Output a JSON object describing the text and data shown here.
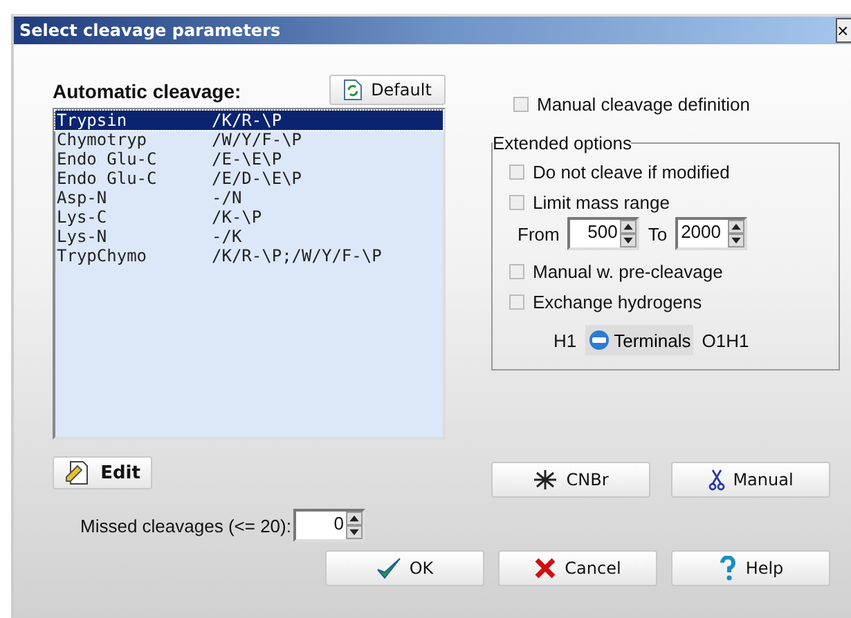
{
  "window": {
    "title": "Select cleavage parameters",
    "close": "×"
  },
  "automatic": {
    "label": "Automatic cleavage:",
    "default_button": "Default",
    "enzymes": [
      {
        "name": "Trypsin",
        "rule": "/K/R-\\P",
        "selected": true
      },
      {
        "name": "Chymotryp",
        "rule": "/W/Y/F-\\P",
        "selected": false
      },
      {
        "name": "Endo Glu-C",
        "rule": "/E-\\E\\P",
        "selected": false
      },
      {
        "name": "Endo Glu-C",
        "rule": "/E/D-\\E\\P",
        "selected": false
      },
      {
        "name": "Asp-N",
        "rule": "-/N",
        "selected": false
      },
      {
        "name": "Lys-C",
        "rule": "/K-\\P",
        "selected": false
      },
      {
        "name": "Lys-N",
        "rule": "-/K",
        "selected": false
      },
      {
        "name": "TrypChymo",
        "rule": "/K/R-\\P;/W/Y/F-\\P",
        "selected": false
      }
    ],
    "edit_button": "Edit"
  },
  "missed": {
    "label": "Missed cleavages (<= 20):",
    "value": "0"
  },
  "manual_definition": {
    "label": "Manual cleavage definition",
    "checked": false
  },
  "extended": {
    "title": "Extended options",
    "not_cleave_modified": {
      "label": "Do not cleave if modified",
      "checked": false
    },
    "limit_mass": {
      "label": "Limit mass range",
      "checked": false,
      "from_label": "From",
      "from": "500",
      "to_label": "To",
      "to": "2000"
    },
    "pre_cleavage": {
      "label": "Manual w. pre-cleavage",
      "checked": false
    },
    "exchange": {
      "label": "Exchange hydrogens",
      "checked": false,
      "left": "H1",
      "terminals": "Terminals",
      "right": "O1H1"
    }
  },
  "buttons": {
    "cnbr": "CNBr",
    "manual": "Manual",
    "ok": "OK",
    "cancel": "Cancel",
    "help": "Help"
  }
}
